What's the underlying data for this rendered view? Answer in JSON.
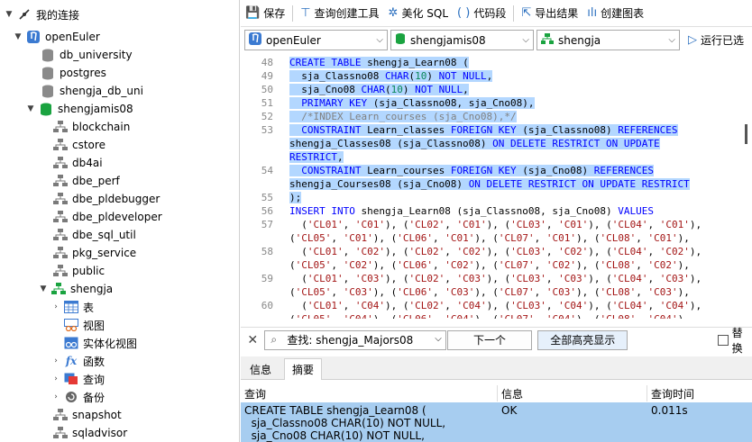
{
  "sidebar": {
    "root_label": "我的连接",
    "connection": "openEuler",
    "databases": [
      "db_university",
      "postgres",
      "shengja_db_uni"
    ],
    "active_db": "shengjamis08",
    "schemas": [
      "blockchain",
      "cstore",
      "db4ai",
      "dbe_perf",
      "dbe_pldebugger",
      "dbe_pldeveloper",
      "dbe_sql_util",
      "pkg_service",
      "public"
    ],
    "active_schema": "shengja",
    "schema_children": [
      "表",
      "视图",
      "实体化视图",
      "函数",
      "查询",
      "备份"
    ],
    "more_schemas": [
      "snapshot",
      "sqladvisor"
    ]
  },
  "toolbar": {
    "save": "保存",
    "query_builder": "查询创建工具",
    "beautify": "美化 SQL",
    "snippet": "代码段",
    "export": "导出结果",
    "create_chart": "创建图表"
  },
  "combos": {
    "connection": "openEuler",
    "database": "shengjamis08",
    "schema": "shengja",
    "run": "运行已选"
  },
  "editor": {
    "line_numbers": [
      "48",
      "49",
      "50",
      "51",
      "52",
      "53",
      "",
      "",
      "54",
      "",
      "55",
      "56",
      "57",
      "",
      "58",
      "",
      "59",
      "",
      "60",
      ""
    ]
  },
  "findbar": {
    "search_text": "查找: shengja_Majors08",
    "next": "下一个",
    "highlight_all": "全部高亮显示",
    "replace": "替换"
  },
  "tabs": {
    "info": "信息",
    "summary": "摘要"
  },
  "result": {
    "headers": [
      "查询",
      "信息",
      "查询时间"
    ],
    "rows": [
      {
        "query": "CREATE TABLE shengja_Learn08 (\n  sja_Classno08 CHAR(10) NOT NULL,\n  sja_Cno08 CHAR(10) NOT NULL,",
        "info": "OK",
        "time": "0.011s"
      }
    ]
  }
}
